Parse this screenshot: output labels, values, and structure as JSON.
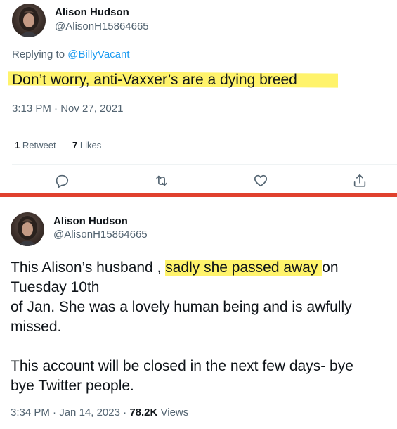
{
  "tweet1": {
    "author_name": "Alison Hudson",
    "author_handle": "@AlisonH15864665",
    "replying_to_prefix": "Replying to",
    "replying_to_handle": "@BillyVacant",
    "text": "Don’t worry, anti-Vaxxer’s are a dying breed",
    "time": "3:13 PM",
    "separator": "·",
    "date": "Nov 27, 2021",
    "retweets_count": "1",
    "retweets_label": "Retweet",
    "likes_count": "7",
    "likes_label": "Likes",
    "actions": [
      "reply-icon",
      "retweet-icon",
      "like-icon",
      "share-icon"
    ],
    "highlight_color": "#fff36b"
  },
  "divider_color": "#e0412e",
  "tweet2": {
    "author_name": "Alison Hudson",
    "author_handle": "@AlisonH15864665",
    "text_part1": "This Alison’s husband , ",
    "text_highlight": "sadly she passed away ",
    "text_part2": "on",
    "text_line2": "Tuesday 10th",
    "text_line3": "of Jan. She was a lovely human being and is awfully",
    "text_line4": "missed.",
    "text_para2_line1": "This account will be closed in the next few days- bye",
    "text_para2_line2": "bye Twitter people.",
    "time": "3:34 PM",
    "separator1": "·",
    "date": "Jan 14, 2023",
    "separator2": "·",
    "views_count": "78.2K",
    "views_label": "Views",
    "highlight_color": "#fff36b"
  }
}
